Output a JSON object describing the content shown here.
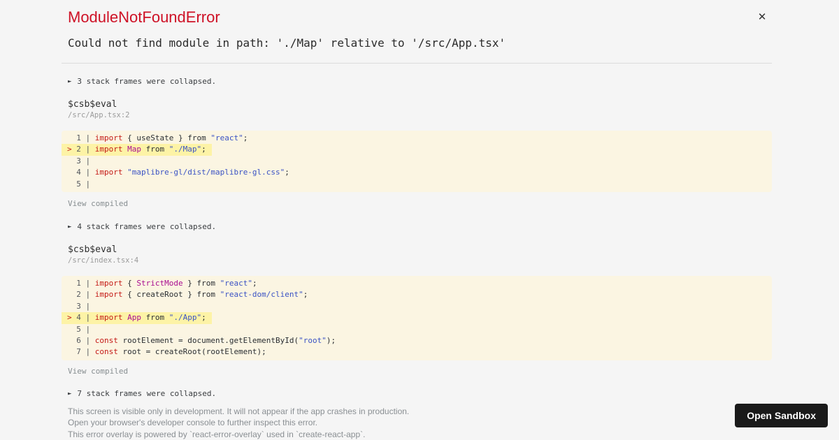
{
  "colors": {
    "title_red": "#ce1126",
    "keyword_red": "#c41a16",
    "capitalized_magenta": "#a90d91",
    "string_blue": "#3b53c4",
    "code_bg": "#fbf5e2",
    "highlight_yellow": "#fdf3a6",
    "button_dark": "#1a1a1a"
  },
  "icons": {
    "close": "✕",
    "expand_arrow": "►"
  },
  "header": {
    "title": "ModuleNotFoundError",
    "message": "Could not find module in path: './Map' relative to '/src/App.tsx'"
  },
  "frames": [
    {
      "collapsed": "3 stack frames were collapsed.",
      "function": "$csb$eval",
      "location": "/src/App.tsx:2",
      "view_compiled": "View compiled",
      "code": {
        "lines": [
          {
            "h": false,
            "tokens": [
              [
                "  1 | ",
                "ln"
              ],
              [
                "import",
                "k"
              ],
              [
                " { useState } from ",
                "p"
              ],
              [
                "\"react\"",
                "s"
              ],
              [
                ";",
                "p"
              ]
            ]
          },
          {
            "h": true,
            "tokens": [
              [
                ">",
                "mark"
              ],
              [
                " 2 | ",
                "ln"
              ],
              [
                "import",
                "k"
              ],
              [
                " ",
                "p"
              ],
              [
                "Map",
                "cap"
              ],
              [
                " from ",
                "p"
              ],
              [
                "\"./Map\"",
                "s"
              ],
              [
                ";",
                "p"
              ]
            ]
          },
          {
            "h": false,
            "tokens": [
              [
                "  3 | ",
                "ln"
              ]
            ]
          },
          {
            "h": false,
            "tokens": [
              [
                "  4 | ",
                "ln"
              ],
              [
                "import",
                "k"
              ],
              [
                " ",
                "p"
              ],
              [
                "\"maplibre-gl/dist/maplibre-gl.css\"",
                "s"
              ],
              [
                ";",
                "p"
              ]
            ]
          },
          {
            "h": false,
            "tokens": [
              [
                "  5 | ",
                "ln"
              ]
            ]
          }
        ]
      }
    },
    {
      "collapsed": "4 stack frames were collapsed.",
      "function": "$csb$eval",
      "location": "/src/index.tsx:4",
      "view_compiled": "View compiled",
      "code": {
        "lines": [
          {
            "h": false,
            "tokens": [
              [
                "  1 | ",
                "ln"
              ],
              [
                "import",
                "k"
              ],
              [
                " { ",
                "p"
              ],
              [
                "StrictMode",
                "cap"
              ],
              [
                " } from ",
                "p"
              ],
              [
                "\"react\"",
                "s"
              ],
              [
                ";",
                "p"
              ]
            ]
          },
          {
            "h": false,
            "tokens": [
              [
                "  2 | ",
                "ln"
              ],
              [
                "import",
                "k"
              ],
              [
                " { createRoot } from ",
                "p"
              ],
              [
                "\"react-dom/client\"",
                "s"
              ],
              [
                ";",
                "p"
              ]
            ]
          },
          {
            "h": false,
            "tokens": [
              [
                "  3 | ",
                "ln"
              ]
            ]
          },
          {
            "h": true,
            "tokens": [
              [
                ">",
                "mark"
              ],
              [
                " 4 | ",
                "ln"
              ],
              [
                "import",
                "k"
              ],
              [
                " ",
                "p"
              ],
              [
                "App",
                "cap"
              ],
              [
                " from ",
                "p"
              ],
              [
                "\"./App\"",
                "s"
              ],
              [
                ";",
                "p"
              ]
            ]
          },
          {
            "h": false,
            "tokens": [
              [
                "  5 | ",
                "ln"
              ]
            ]
          },
          {
            "h": false,
            "tokens": [
              [
                "  6 | ",
                "ln"
              ],
              [
                "const",
                "k"
              ],
              [
                " rootElement = document.getElementById(",
                "p"
              ],
              [
                "\"root\"",
                "s"
              ],
              [
                ");",
                "p"
              ]
            ]
          },
          {
            "h": false,
            "tokens": [
              [
                "  7 | ",
                "ln"
              ],
              [
                "const",
                "k"
              ],
              [
                " root = createRoot(rootElement);",
                "p"
              ]
            ]
          }
        ]
      }
    },
    {
      "collapsed": "7 stack frames were collapsed."
    }
  ],
  "footer": {
    "lines": [
      "This screen is visible only in development. It will not appear if the app crashes in production.",
      "Open your browser's developer console to further inspect this error.",
      "This error overlay is powered by `react-error-overlay` used in `create-react-app`."
    ]
  },
  "open_sandbox": {
    "label": "Open Sandbox"
  }
}
